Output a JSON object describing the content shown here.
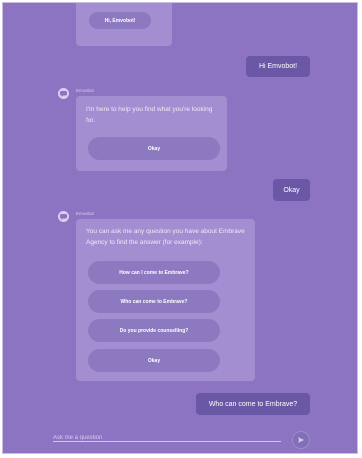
{
  "chat": {
    "top_reply_label": "Hi, Emvobot!",
    "user_msg_1": "Hi Emvobot!",
    "bot_name": "Emvobot",
    "bot_msg_1": "I'm here to help you find what you're looking for.",
    "okay_label": "Okay",
    "user_msg_2": "Okay",
    "bot_msg_2": "You can ask me any question you have about Embrave Agency to find the answer (for example):",
    "option_1": "How can I come to Embrave?",
    "option_2": "Who can come to Embrave?",
    "option_3": "Do you provide counselling?",
    "option_4": "Okay",
    "user_msg_3": "Who can come to Embrave?"
  },
  "composer": {
    "placeholder": "Ask me a question",
    "send_icon": "send-icon"
  },
  "colors": {
    "background": "#8d74c2",
    "bot_card": "#a28ed0",
    "pill": "#8c79c0",
    "user_bubble": "#6a57a6"
  }
}
